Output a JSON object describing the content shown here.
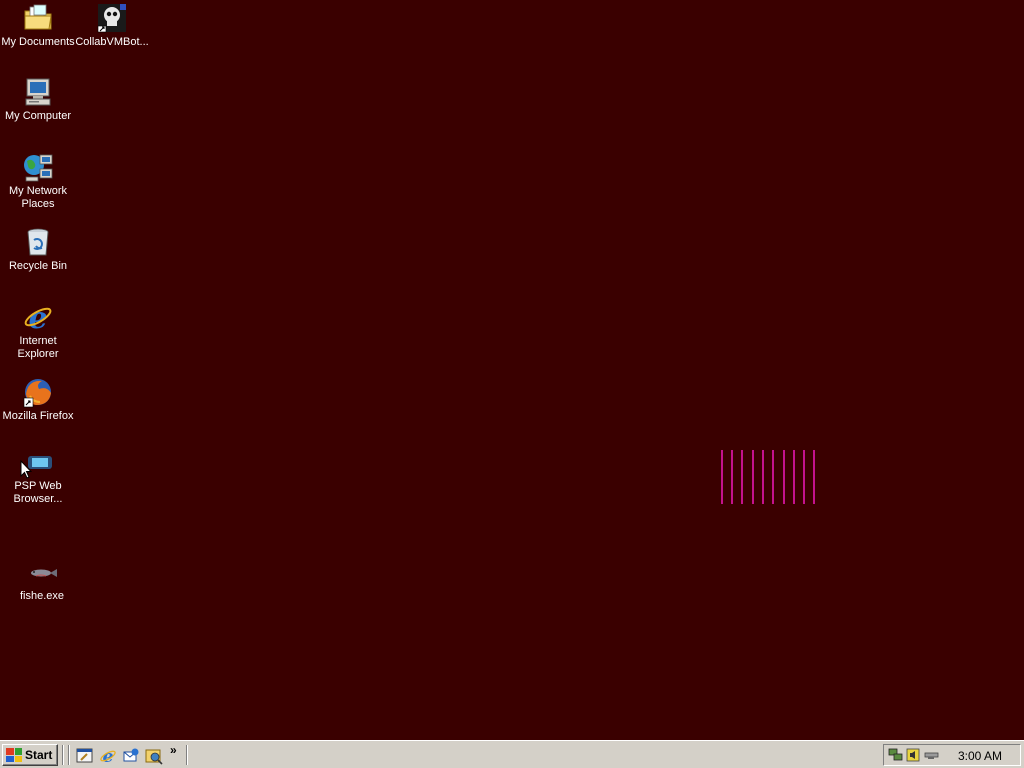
{
  "desktop": {
    "background_color": "#3a0000",
    "icons": [
      {
        "label": "My Documents",
        "icon": "folder-documents-icon"
      },
      {
        "label": "CollabVMBot...",
        "icon": "skull-shortcut-icon"
      },
      {
        "label": "My Computer",
        "icon": "computer-icon"
      },
      {
        "label": "My Network Places",
        "icon": "network-places-icon"
      },
      {
        "label": "Recycle Bin",
        "icon": "recycle-bin-icon"
      },
      {
        "label": "Internet Explorer",
        "icon": "internet-explorer-icon"
      },
      {
        "label": "Mozilla Firefox",
        "icon": "firefox-icon"
      },
      {
        "label": "PSP Web Browser...",
        "icon": "psp-browser-icon"
      },
      {
        "label": "fishe.exe",
        "icon": "fish-icon"
      }
    ]
  },
  "taskbar": {
    "start_label": "Start",
    "quick_launch": [
      "show-desktop-icon",
      "internet-explorer-icon",
      "outlook-express-icon",
      "media-player-icon"
    ],
    "more": "»",
    "tray_icons": [
      "network-icon",
      "volume-icon",
      "monitor-icon"
    ],
    "clock": "3:00 AM"
  }
}
